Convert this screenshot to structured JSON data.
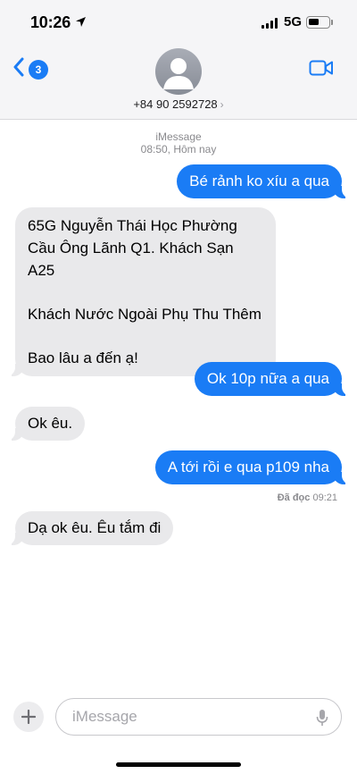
{
  "status_bar": {
    "time": "10:26",
    "network": "5G",
    "battery_level": 0.55
  },
  "header": {
    "back_badge_count": "3",
    "contact_name": "+84 90 2592728",
    "contact_chevron": "›",
    "icons": [
      "chevron-left-icon",
      "person-icon",
      "video-icon"
    ],
    "accent_color": "#1a7cf5"
  },
  "thread": {
    "service": "iMessage",
    "timestamp": "08:50, Hôm nay",
    "messages": [
      {
        "direction": "sent",
        "lines": [
          "Bé rảnh ko xíu a qua"
        ]
      },
      {
        "direction": "received",
        "lines": [
          "65G Nguyễn Thái Học Phường",
          "Cầu Ông Lãnh Q1. Khách Sạn A25",
          "",
          "Khách Nước Ngoài Phụ Thu Thêm",
          "",
          "Bao lâu a đến ạ!"
        ]
      },
      {
        "direction": "sent",
        "lines": [
          "Ok 10p nữa a qua"
        ]
      },
      {
        "direction": "received",
        "lines": [
          "Ok êu."
        ]
      },
      {
        "direction": "sent",
        "lines": [
          "A tới rồi e qua p109 nha"
        ]
      },
      {
        "direction": "received",
        "lines": [
          "Dạ ok êu. Êu tắm đi"
        ]
      }
    ],
    "read_receipt": {
      "label": "Đã đọc",
      "time": "09:21"
    }
  },
  "composer": {
    "placeholder": "iMessage",
    "value": "",
    "icons": [
      "plus-icon",
      "microphone-icon"
    ]
  }
}
